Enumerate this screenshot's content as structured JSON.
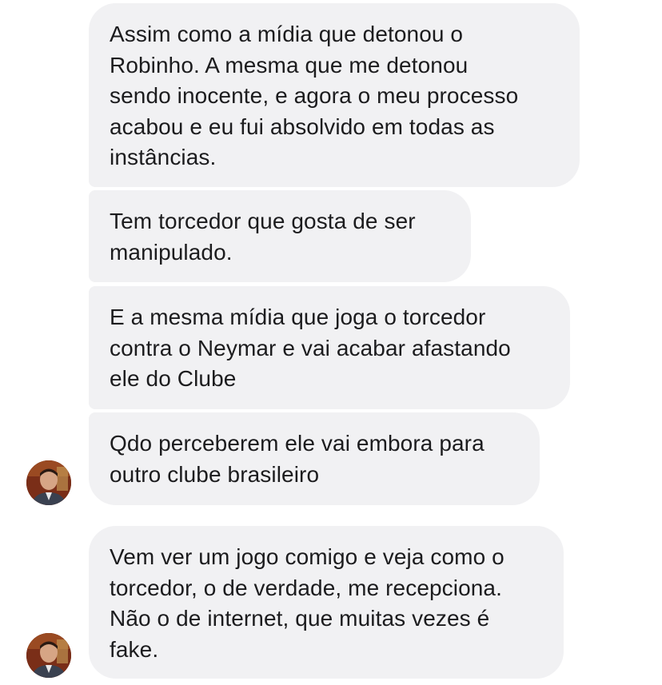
{
  "conversation": {
    "messages": [
      {
        "text": "Assim como a mídia que detonou o\nRobinho. A mesma que me detonou\nsendo inocente, e agora o meu processo\nacabou e eu fui absolvido em todas as\ninstâncias."
      },
      {
        "text": "Tem torcedor que gosta de ser\nmanipulado."
      },
      {
        "text": "E a mesma mídia que joga o torcedor\ncontra o Neymar e vai acabar afastando\nele do Clube"
      },
      {
        "text": "Qdo perceberem ele vai embora para\noutro clube brasileiro"
      },
      {
        "text": "Vem ver um jogo comigo e veja como o\ntorcedor, o de verdade, me recepciona.\nNão o de internet, que muitas vezes é\nfake."
      }
    ]
  },
  "colors": {
    "bubble_background": "#f1f1f3",
    "text": "#1c1c1e",
    "page_background": "#ffffff"
  },
  "icons": {
    "sender_avatar": "avatar-photo-icon"
  }
}
